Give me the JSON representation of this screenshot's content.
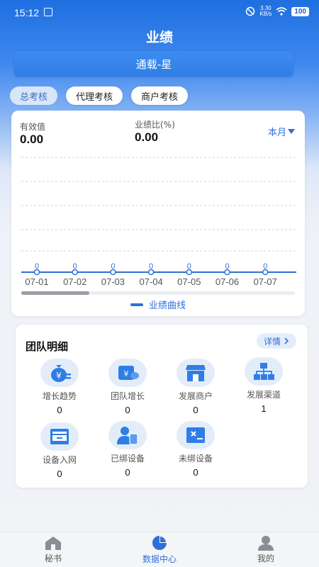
{
  "status_bar": {
    "time": "15:12",
    "net_speed": "3.30",
    "net_unit": "KB/s",
    "battery": "100"
  },
  "title": "业绩",
  "store_name": "通载-星",
  "tabs": [
    {
      "label": "总考核",
      "active": true
    },
    {
      "label": "代理考核",
      "active": false
    },
    {
      "label": "商户考核",
      "active": false
    }
  ],
  "metrics": {
    "valid_label": "有效值",
    "valid_value": "0.00",
    "ratio_label": "业绩比(%)",
    "ratio_value": "0.00"
  },
  "period_selector": "本月",
  "chart_data": {
    "type": "line",
    "x": [
      "07-01",
      "07-02",
      "07-03",
      "07-04",
      "07-05",
      "07-06",
      "07-07"
    ],
    "series": [
      {
        "name": "业绩曲线",
        "values": [
          0,
          0,
          0,
          0,
          0,
          0,
          0
        ],
        "data_labels": [
          "0",
          "0",
          "0",
          "0",
          "0",
          "0",
          "0"
        ]
      }
    ],
    "grid": true,
    "legend": "bottom",
    "accent_color": "#2f6fd8"
  },
  "team": {
    "title": "团队明细",
    "detail_label": "详情",
    "items": [
      {
        "label": "增长趋势",
        "value": "0",
        "icon": "money-bag-icon"
      },
      {
        "label": "团队增长",
        "value": "0",
        "icon": "wallet-icon"
      },
      {
        "label": "发展商户",
        "value": "0",
        "icon": "store-icon"
      },
      {
        "label": "发展渠道",
        "value": "1",
        "icon": "org-chart-icon"
      },
      {
        "label": "设备入网",
        "value": "0",
        "icon": "inbox-icon"
      },
      {
        "label": "已绑设备",
        "value": "0",
        "icon": "user-device-icon"
      },
      {
        "label": "未绑设备",
        "value": "0",
        "icon": "unbound-device-icon"
      }
    ]
  },
  "tabbar": [
    {
      "label": "秘书",
      "icon": "home-icon",
      "active": false
    },
    {
      "label": "数据中心",
      "icon": "pie-chart-icon",
      "active": true
    },
    {
      "label": "我的",
      "icon": "profile-icon",
      "active": false
    }
  ]
}
